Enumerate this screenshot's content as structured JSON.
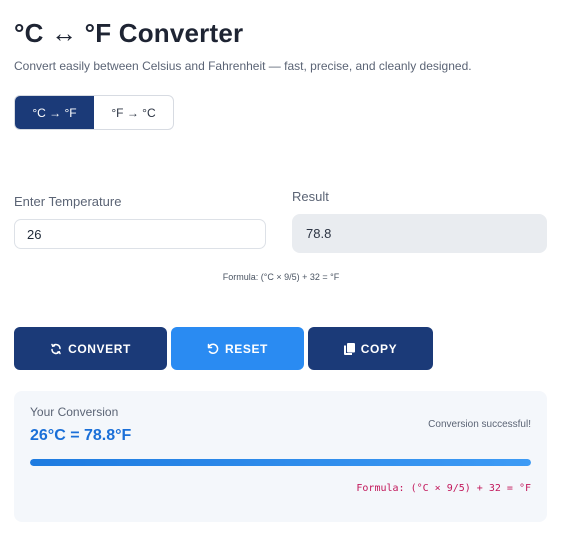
{
  "header": {
    "title": "°C ↔ °F Converter",
    "subtitle": "Convert easily between Celsius and Fahrenheit — fast, precise, and cleanly designed."
  },
  "mode_toggle": {
    "options": [
      {
        "label": "°C → °F",
        "active": true
      },
      {
        "label": "°F → °C",
        "active": false
      }
    ]
  },
  "input": {
    "label": "Enter Temperature",
    "value": "26"
  },
  "result": {
    "label": "Result",
    "value": "78.8"
  },
  "formula_hint": "Formula: (°C × 9/5) + 32 = °F",
  "buttons": {
    "convert": {
      "label": "CONVERT",
      "icon": "refresh-icon"
    },
    "reset": {
      "label": "RESET",
      "icon": "undo-icon"
    },
    "copy": {
      "label": "COPY",
      "icon": "copy-icon"
    }
  },
  "conversion_card": {
    "label": "Your Conversion",
    "value": "26°C = 78.8°F",
    "status": "Conversion successful!",
    "progress": 1.0,
    "formula": "Formula: (°C × 9/5) + 32 = °F"
  },
  "colors": {
    "primary": "#1b3a78",
    "accent": "#2a8bf2",
    "highlight_text": "#1a6fd8",
    "formula_text": "#c2185b"
  }
}
